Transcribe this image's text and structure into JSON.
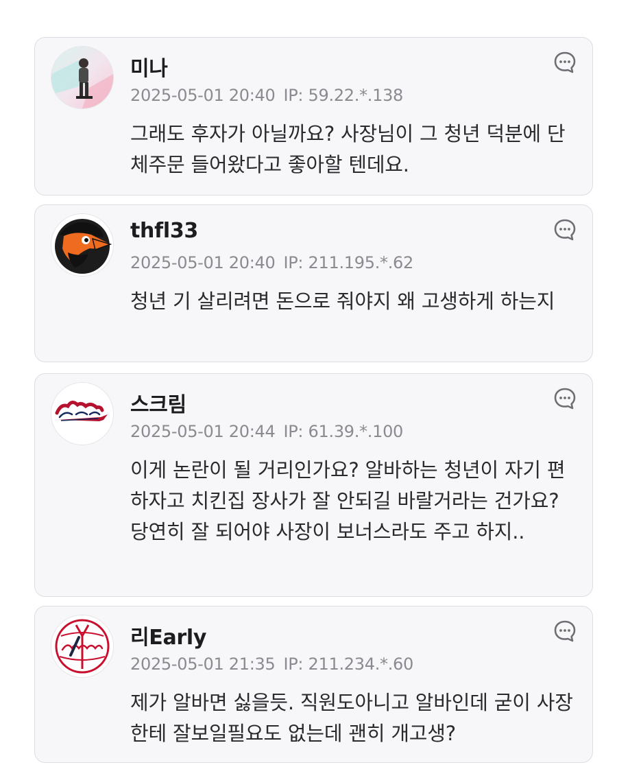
{
  "comments": [
    {
      "username": "미나",
      "timestamp": "2025-05-01 20:40",
      "ip": "IP: 59.22.*.138",
      "text": "그래도 후자가 아닐까요? 사장님이 그 청년 덕분에 단체주문 들어왔다고 좋아할 텐데요.",
      "avatar_icon": "profile-photo-person"
    },
    {
      "username": "thfl33",
      "timestamp": "2025-05-01 20:40",
      "ip": "IP: 211.195.*.62",
      "text": "청년 기 살리려면 돈으로 줘야지 왜 고생하게 하는지",
      "avatar_icon": "orioles-bird-logo"
    },
    {
      "username": "스크림",
      "timestamp": "2025-05-01 20:44",
      "ip": "IP: 61.39.*.100",
      "text": "이게 논란이 될 거리인가요? 알바하는 청년이 자기 편하자고 치킨집 장사가 잘 안되길 바랄거라는 건가요? 당연히 잘 되어야 사장이 보너스라도 주고 하지..",
      "avatar_icon": "braves-logo"
    },
    {
      "username": "리Early",
      "timestamp": "2025-05-01 21:35",
      "ip": "IP: 211.234.*.60",
      "text": "제가 알바면 싫을듯. 직원도아니고 알바인데 굳이 사장한테 잘보일필요도 없는데 괜히 개고생?",
      "avatar_icon": "yankees-logo"
    }
  ],
  "reply_icon": "comment-bubble-icon",
  "colors": {
    "card_bg": "#f7f7f9",
    "card_border": "#dcdce2",
    "meta_text": "#8a8a90",
    "body_text": "#2a2a2e"
  }
}
